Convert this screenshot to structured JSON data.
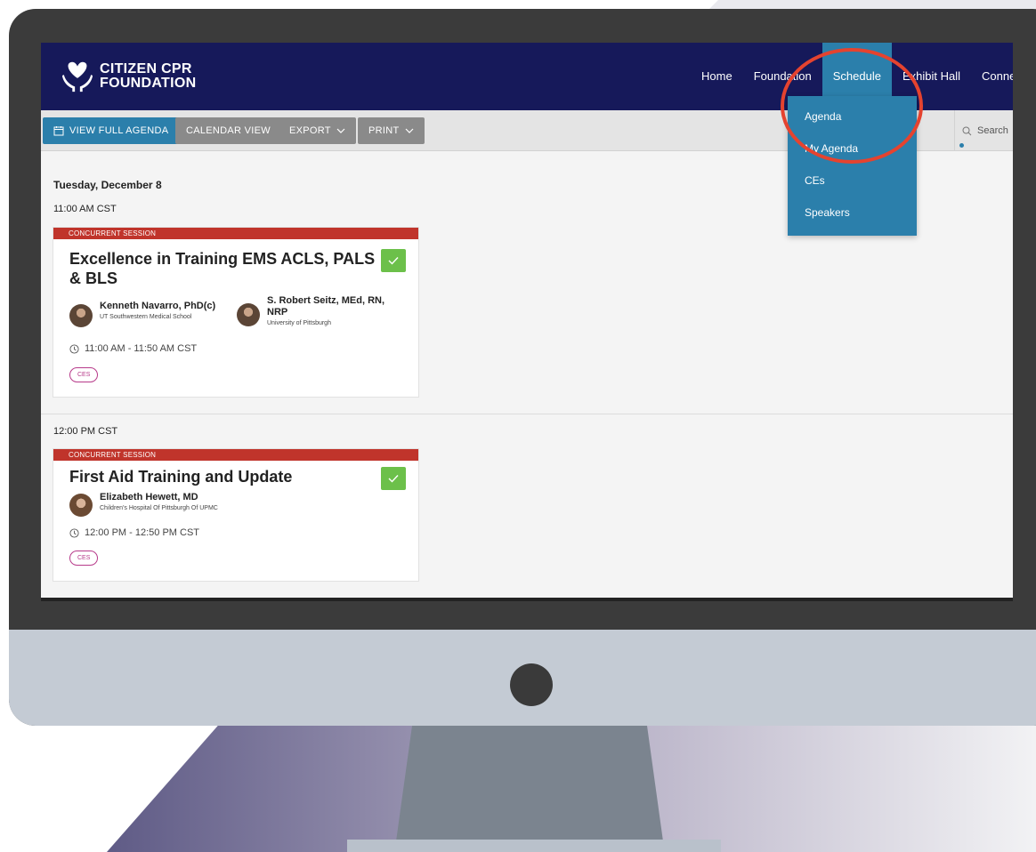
{
  "colors": {
    "nav_bg": "#16195a",
    "accent": "#2b7fab",
    "tag_red": "#c0342b",
    "check_green": "#6cc04a",
    "highlight_circle": "#e5432f",
    "pill_magenta": "#b73a8a"
  },
  "logo": {
    "line1": "CITIZEN CPR",
    "line2": "FOUNDATION",
    "icon": "heart-hands-icon"
  },
  "nav": {
    "items": [
      "Home",
      "Foundation",
      "Schedule",
      "Exhibit Hall",
      "Connec"
    ],
    "active": "Schedule"
  },
  "schedule_menu": {
    "items": [
      "Agenda",
      "My Agenda",
      "CEs",
      "Speakers"
    ]
  },
  "toolbar": {
    "view_full_agenda": "VIEW FULL AGENDA",
    "calendar_view": "CALENDAR VIEW",
    "export": "EXPORT",
    "print": "PRINT",
    "search_placeholder": "Search"
  },
  "agenda": {
    "date": "Tuesday, December 8",
    "slots": [
      {
        "time": "11:00 AM CST",
        "session": {
          "tag": "CONCURRENT SESSION",
          "title_line1": "Excellence in Training EMS ACLS, PALS",
          "title_line2": "& BLS",
          "speakers": [
            {
              "name": "Kenneth Navarro, PhD(c)",
              "org": "UT Southwestern Medical School"
            },
            {
              "name_line1": "S. Robert Seitz, MEd, RN,",
              "name_line2": "NRP",
              "org": "University of Pittsburgh"
            }
          ],
          "time_range": "11:00 AM - 11:50 AM CST",
          "badge": "CES"
        }
      },
      {
        "time": "12:00 PM CST",
        "session": {
          "tag": "CONCURRENT SESSION",
          "title": "First Aid Training and Update",
          "speakers": [
            {
              "name": "Elizabeth Hewett, MD",
              "org": "Children's Hospital Of Pittsburgh Of UPMC"
            }
          ],
          "time_range": "12:00 PM - 12:50 PM CST",
          "badge": "CES"
        }
      }
    ]
  }
}
